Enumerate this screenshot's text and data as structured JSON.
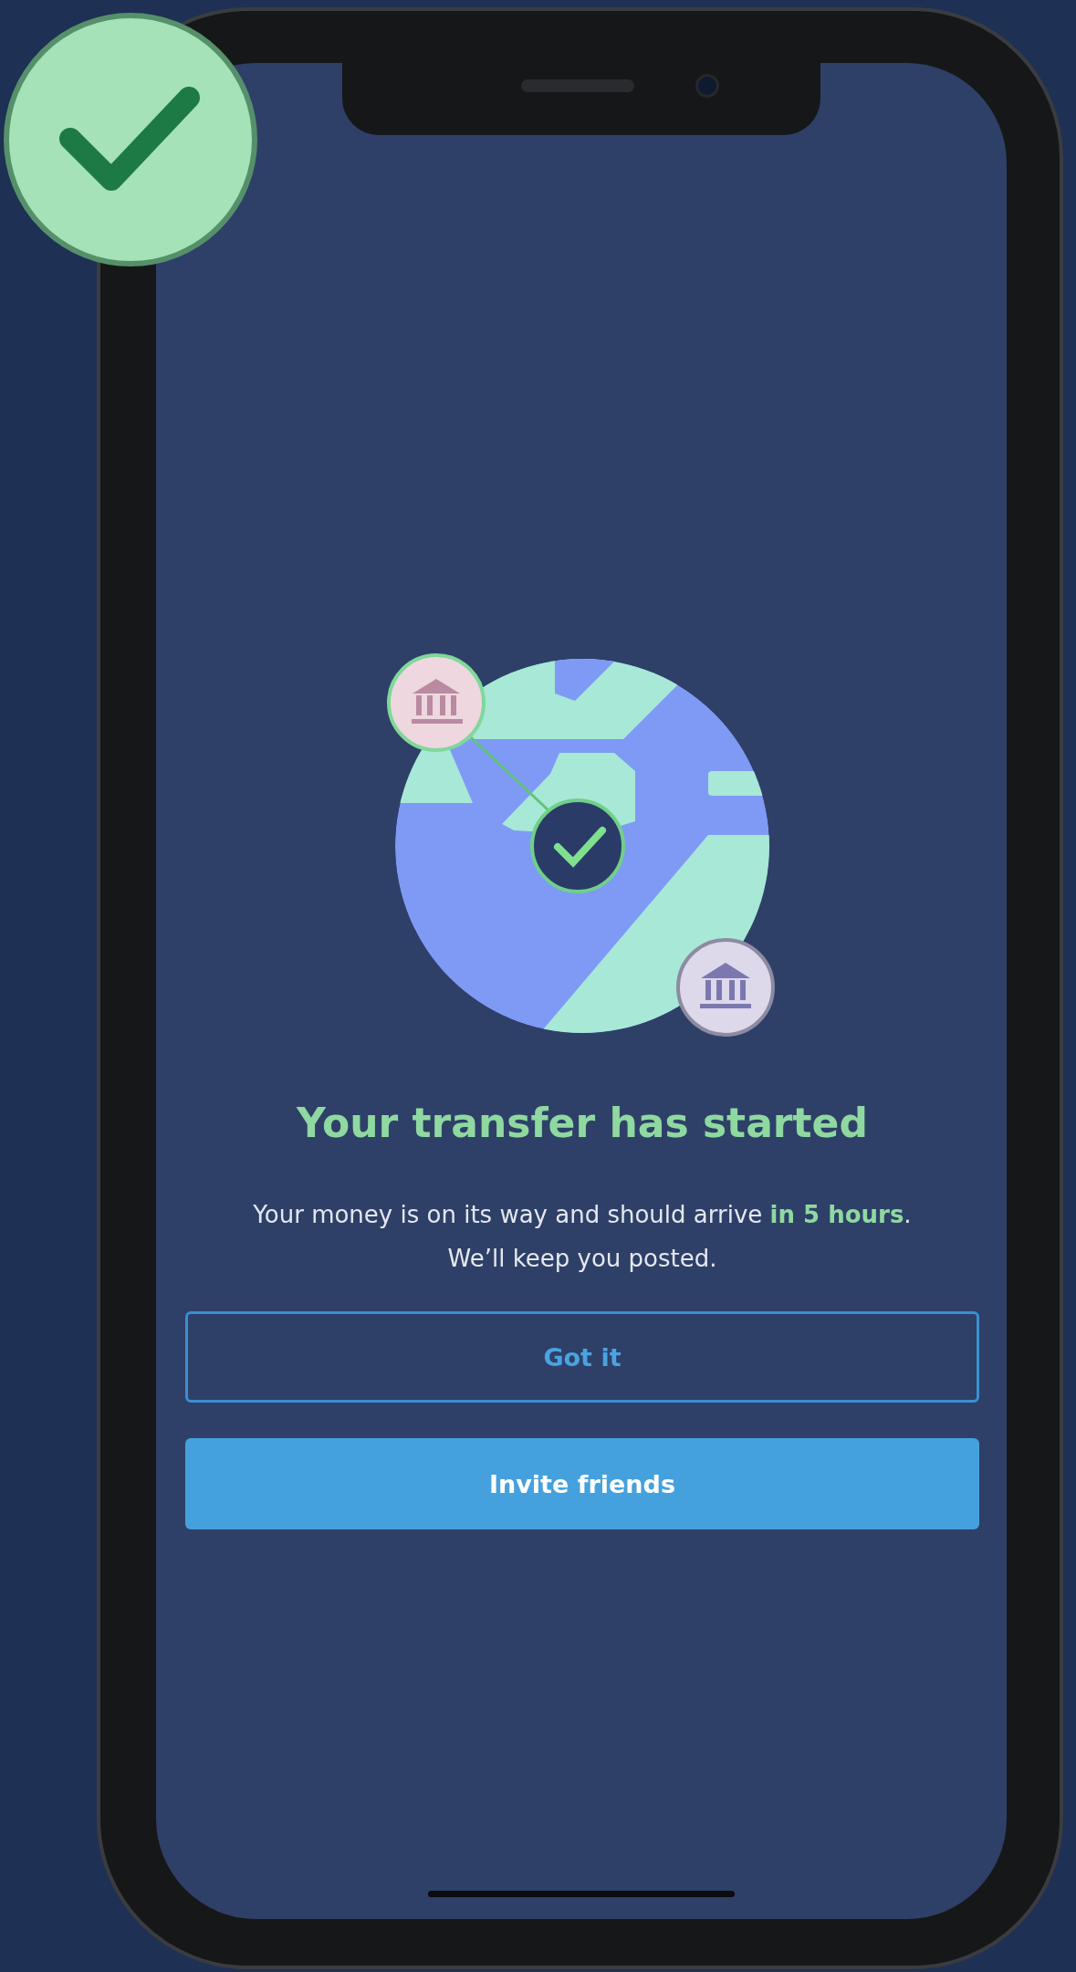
{
  "screen": {
    "title": "Your transfer has started",
    "message_lines": [
      "Your money is on its way and should arrive **in 5 hours**.",
      "We’ll keep you posted."
    ],
    "buttons": [
      {
        "label": "Got it",
        "kind": "outline"
      },
      {
        "label": "Invite friends",
        "kind": "filled"
      }
    ]
  }
}
